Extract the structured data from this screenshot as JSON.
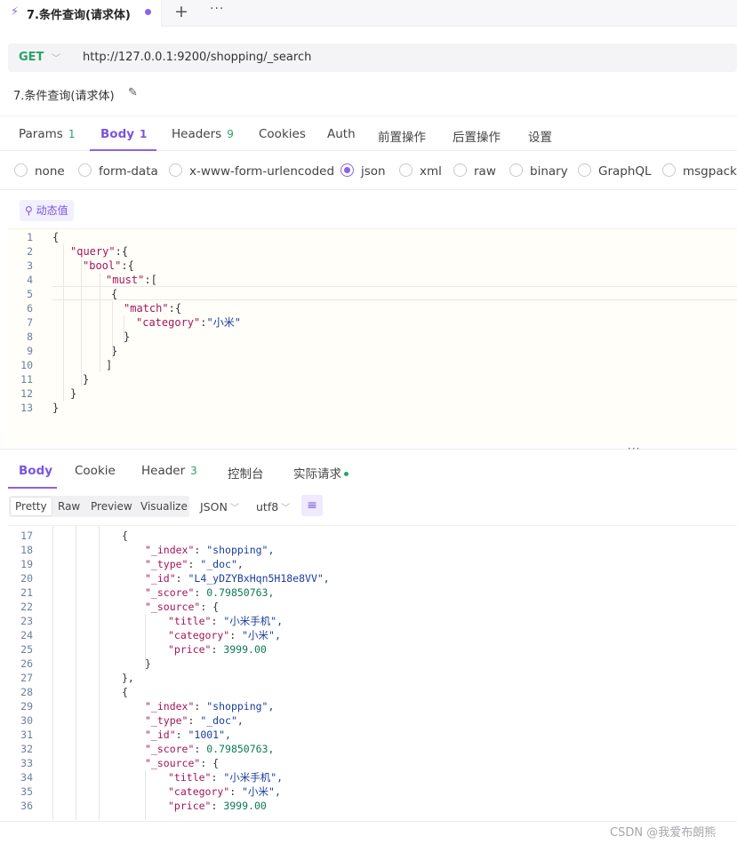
{
  "tab": {
    "title": "7.条件查询(请求体)",
    "bolt": "⚡",
    "plus": "+",
    "more": "···"
  },
  "request": {
    "method": "GET",
    "url": "http://127.0.0.1:9200/shopping/_search",
    "name": "7.条件查询(请求体)"
  },
  "req_tabs": [
    {
      "label": "Params",
      "count": "1"
    },
    {
      "label": "Body",
      "count": "1"
    },
    {
      "label": "Headers",
      "count": "9"
    },
    {
      "label": "Cookies"
    },
    {
      "label": "Auth"
    },
    {
      "label": "前置操作"
    },
    {
      "label": "后置操作"
    },
    {
      "label": "设置"
    }
  ],
  "body_types": [
    "none",
    "form-data",
    "x-www-form-urlencoded",
    "json",
    "xml",
    "raw",
    "binary",
    "GraphQL",
    "msgpack"
  ],
  "selected_body_type": "json",
  "dynamic_value_label": "动态值",
  "request_body": [
    {
      "n": "1",
      "text": "{"
    },
    {
      "n": "2",
      "text": "\"query\":{"
    },
    {
      "n": "3",
      "text": "\"bool\":{"
    },
    {
      "n": "4",
      "text": "\"must\":["
    },
    {
      "n": "5",
      "text": "{"
    },
    {
      "n": "6",
      "text": "\"match\":{"
    },
    {
      "n": "7",
      "text": "\"category\":\"小米\""
    },
    {
      "n": "8",
      "text": "}"
    },
    {
      "n": "9",
      "text": "}"
    },
    {
      "n": "10",
      "text": "]"
    },
    {
      "n": "11",
      "text": "}"
    },
    {
      "n": "12",
      "text": "}"
    },
    {
      "n": "13",
      "text": "}"
    }
  ],
  "resize_dots": "···",
  "resp_tabs": [
    {
      "label": "Body"
    },
    {
      "label": "Cookie"
    },
    {
      "label": "Header",
      "count": "3"
    },
    {
      "label": "控制台"
    },
    {
      "label": "实际请求"
    }
  ],
  "resp_toolbar": {
    "views": [
      "Pretty",
      "Raw",
      "Preview",
      "Visualize"
    ],
    "format": "JSON",
    "encoding": "utf8"
  },
  "response_lines": [
    {
      "n": "17",
      "text": "{"
    },
    {
      "n": "18",
      "text": "\"_index\": \"shopping\","
    },
    {
      "n": "19",
      "text": "\"_type\": \"_doc\","
    },
    {
      "n": "20",
      "text": "\"_id\": \"L4_yDZYBxHqn5H18e8VV\","
    },
    {
      "n": "21",
      "text": "\"_score\": 0.79850763,"
    },
    {
      "n": "22",
      "text": "\"_source\": {"
    },
    {
      "n": "23",
      "text": "\"title\": \"小米手机\","
    },
    {
      "n": "24",
      "text": "\"category\": \"小米\","
    },
    {
      "n": "25",
      "text": "\"price\": 3999.00"
    },
    {
      "n": "26",
      "text": "}"
    },
    {
      "n": "27",
      "text": "},"
    },
    {
      "n": "28",
      "text": "{"
    },
    {
      "n": "29",
      "text": "\"_index\": \"shopping\","
    },
    {
      "n": "30",
      "text": "\"_type\": \"_doc\","
    },
    {
      "n": "31",
      "text": "\"_id\": \"1001\","
    },
    {
      "n": "32",
      "text": "\"_score\": 0.79850763,"
    },
    {
      "n": "33",
      "text": "\"_source\": {"
    },
    {
      "n": "34",
      "text": "\"title\": \"小米手机\","
    },
    {
      "n": "35",
      "text": "\"category\": \"小米\","
    },
    {
      "n": "36",
      "text": "\"price\": 3999.00"
    }
  ],
  "watermark": "CSDN @我爱布朗熊",
  "colors": {
    "accent": "#8a63e8",
    "get": "#29a36a",
    "key": "#a3155a",
    "string": "#1a3d9c",
    "number": "#0d7a56"
  }
}
